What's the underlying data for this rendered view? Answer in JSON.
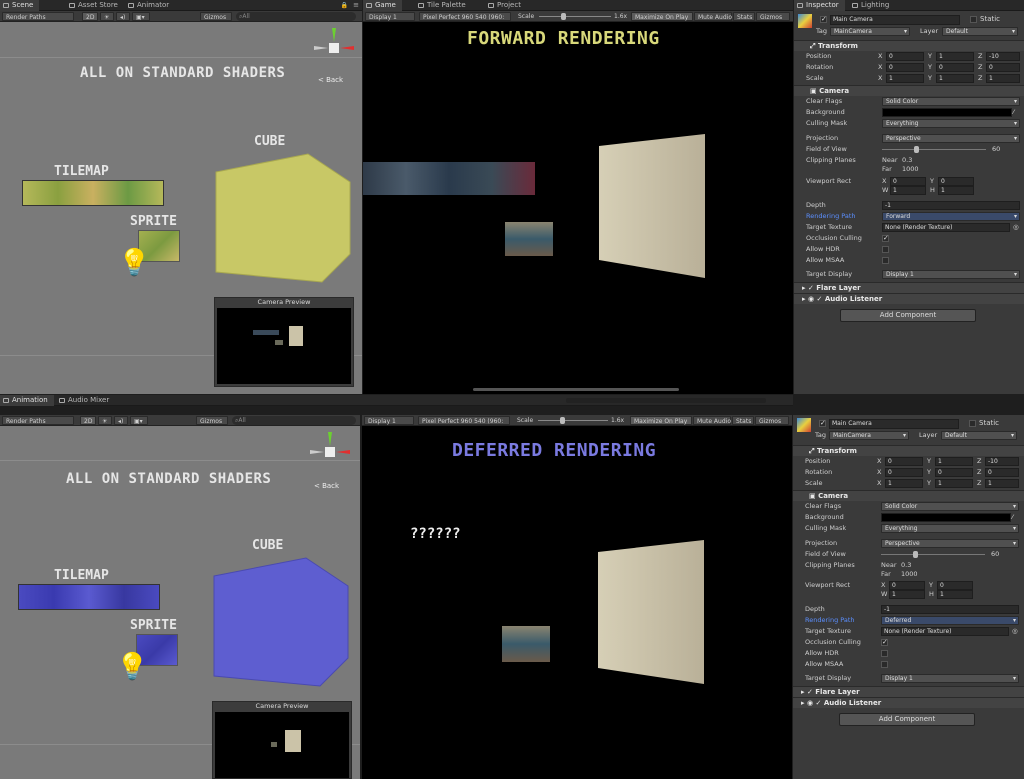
{
  "top": {
    "tabs_left": [
      "Scene",
      "Asset Store",
      "Animator"
    ],
    "tabs_mid": [
      "Game",
      "Tile Palette",
      "Project"
    ],
    "tabs_right": [
      "Inspector",
      "Lighting"
    ],
    "scene_toolbar": {
      "render_paths": "Render Paths",
      "mode_2d": "2D",
      "gizmos": "Gizmos",
      "search": "All"
    },
    "scene": {
      "title": "ALL ON STANDARD SHADERS",
      "cube": "CUBE",
      "tilemap": "TILEMAP",
      "sprite": "SPRITE",
      "back": "Back",
      "camera_preview": "Camera Preview",
      "cube_color": "#c8c866",
      "tilemap_color": "#b5b85a"
    },
    "game_toolbar": {
      "display": "Display 1",
      "resolution": "Pixel Perfect 960 540 (960:",
      "scale_label": "Scale",
      "scale_value": "1.6x",
      "maximize": "Maximize On Play",
      "mute": "Mute Audio",
      "stats": "Stats",
      "gizmos": "Gizmos"
    },
    "game": {
      "title": "FORWARD RENDERING",
      "title_color": "#d8d87a"
    },
    "inspector": {
      "object_name": "Main Camera",
      "static": "Static",
      "tag_label": "Tag",
      "tag_value": "MainCamera",
      "layer_label": "Layer",
      "layer_value": "Default",
      "transform": "Transform",
      "position": "Position",
      "rotation": "Rotation",
      "scale": "Scale",
      "pos": [
        "0",
        "1",
        "-10"
      ],
      "rot": [
        "0",
        "0",
        "0"
      ],
      "scl": [
        "1",
        "1",
        "1"
      ],
      "camera": "Camera",
      "clear_flags": "Clear Flags",
      "clear_flags_value": "Solid Color",
      "background": "Background",
      "culling_mask": "Culling Mask",
      "culling_mask_value": "Everything",
      "projection": "Projection",
      "projection_value": "Perspective",
      "fov": "Field of View",
      "fov_value": "60",
      "clipping": "Clipping Planes",
      "near": "Near",
      "near_value": "0.3",
      "far": "Far",
      "far_value": "1000",
      "viewport": "Viewport Rect",
      "vx": "0",
      "vy": "0",
      "vw": "1",
      "vh": "1",
      "depth": "Depth",
      "depth_value": "-1",
      "rendering_path": "Rendering Path",
      "rendering_path_value": "Forward",
      "target_texture": "Target Texture",
      "target_texture_value": "None (Render Texture)",
      "occlusion": "Occlusion Culling",
      "hdr": "Allow HDR",
      "msaa": "Allow MSAA",
      "target_display": "Target Display",
      "target_display_value": "Display 1",
      "flare": "Flare Layer",
      "audio": "Audio Listener",
      "add_component": "Add Component",
      "occlusion_checked": "✓"
    }
  },
  "bottom": {
    "tabs_left": [
      "Animation",
      "Audio Mixer"
    ],
    "scene_toolbar": {
      "render_paths": "Render Paths",
      "mode_2d": "2D",
      "gizmos": "Gizmos",
      "search": "All"
    },
    "scene": {
      "title": "ALL ON STANDARD SHADERS",
      "cube": "CUBE",
      "tilemap": "TILEMAP",
      "sprite": "SPRITE",
      "back": "Back",
      "camera_preview": "Camera Preview",
      "cube_color": "#5e5ed0",
      "tilemap_color": "#4a4ac0"
    },
    "game_toolbar": {
      "display": "Display 1",
      "resolution": "Pixel Perfect 960 540 (960:",
      "scale_label": "Scale",
      "scale_value": "1.6x",
      "maximize": "Maximize On Play",
      "mute": "Mute Audio",
      "stats": "Stats",
      "gizmos": "Gizmos"
    },
    "game": {
      "title": "DEFERRED RENDERING",
      "title_color": "#7a7ae0",
      "question": "??????"
    },
    "inspector": {
      "object_name": "Main Camera",
      "static": "Static",
      "tag_label": "Tag",
      "tag_value": "MainCamera",
      "layer_label": "Layer",
      "layer_value": "Default",
      "transform": "Transform",
      "position": "Position",
      "rotation": "Rotation",
      "scale": "Scale",
      "pos": [
        "0",
        "1",
        "-10"
      ],
      "rot": [
        "0",
        "0",
        "0"
      ],
      "scl": [
        "1",
        "1",
        "1"
      ],
      "camera": "Camera",
      "clear_flags": "Clear Flags",
      "clear_flags_value": "Solid Color",
      "background": "Background",
      "culling_mask": "Culling Mask",
      "culling_mask_value": "Everything",
      "projection": "Projection",
      "projection_value": "Perspective",
      "fov": "Field of View",
      "fov_value": "60",
      "clipping": "Clipping Planes",
      "near": "Near",
      "near_value": "0.3",
      "far": "Far",
      "far_value": "1000",
      "viewport": "Viewport Rect",
      "vx": "0",
      "vy": "0",
      "vw": "1",
      "vh": "1",
      "depth": "Depth",
      "depth_value": "-1",
      "rendering_path": "Rendering Path",
      "rendering_path_value": "Deferred",
      "target_texture": "Target Texture",
      "target_texture_value": "None (Render Texture)",
      "occlusion": "Occlusion Culling",
      "hdr": "Allow HDR",
      "msaa": "Allow MSAA",
      "target_display": "Target Display",
      "target_display_value": "Display 1",
      "flare": "Flare Layer",
      "audio": "Audio Listener",
      "add_component": "Add Component",
      "occlusion_checked": "✓"
    }
  }
}
